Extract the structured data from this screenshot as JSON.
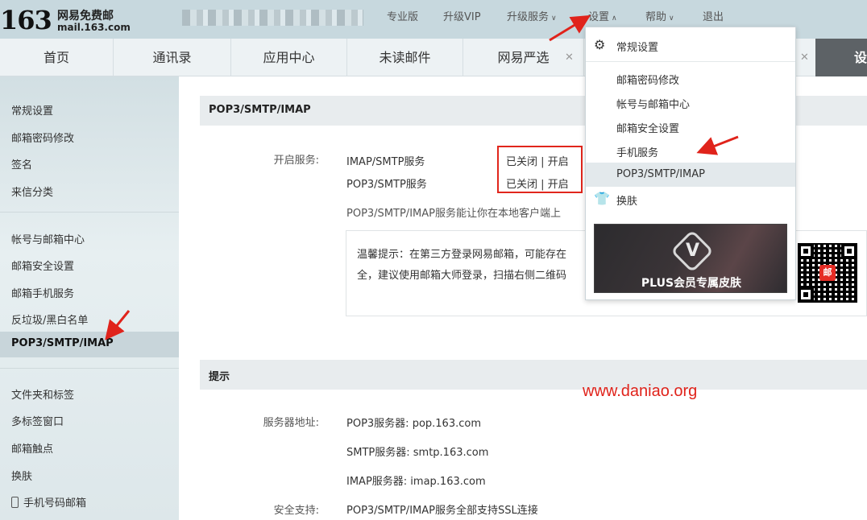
{
  "header": {
    "logo_number": "163",
    "logo_name": "网易免费邮",
    "logo_domain": "mail.163.com",
    "nav": [
      "专业版",
      "升级VIP",
      "升级服务",
      "设置",
      "帮助",
      "退出"
    ]
  },
  "tabs": [
    "首页",
    "通讯录",
    "应用中心",
    "未读邮件",
    "网易严选"
  ],
  "active_tab": "设置",
  "sidebar": {
    "group1": [
      "常规设置",
      "邮箱密码修改",
      "签名",
      "来信分类"
    ],
    "group2": [
      "帐号与邮箱中心",
      "邮箱安全设置",
      "邮箱手机服务",
      "反垃圾/黑白名单"
    ],
    "active": "POP3/SMTP/IMAP",
    "group3": [
      "文件夹和标签",
      "多标签窗口",
      "邮箱触点",
      "换肤",
      "手机号码邮箱"
    ]
  },
  "main": {
    "section1_title": "POP3/SMTP/IMAP",
    "service_label": "开启服务:",
    "services": [
      {
        "name": "IMAP/SMTP服务",
        "status": "已关闭 | 开启"
      },
      {
        "name": "POP3/SMTP服务",
        "status": "已关闭 | 开启"
      }
    ],
    "desc": "POP3/SMTP/IMAP服务能让你在本地客户端上",
    "tip_line1": "温馨提示：在第三方登录网易邮箱，可能存在",
    "tip_line2": "全，建议使用邮箱大师登录，扫描右侧二维码",
    "section2_title": "提示",
    "server_label": "服务器地址:",
    "servers": [
      "POP3服务器: pop.163.com",
      "SMTP服务器: smtp.163.com",
      "IMAP服务器: imap.163.com"
    ],
    "security_label": "安全支持:",
    "security_value": "POP3/SMTP/IMAP服务全部支持SSL连接"
  },
  "dropdown": {
    "general": "常规设置",
    "items": [
      "邮箱密码修改",
      "帐号与邮箱中心",
      "邮箱安全设置",
      "手机服务",
      "POP3/SMTP/IMAP"
    ],
    "skin": "换肤",
    "banner_text": "PLUS会员专属皮肤",
    "banner_letter": "V"
  },
  "qr_badge": "邮",
  "watermark": "www.daniao.org",
  "colors": {
    "accent_red": "#e0231b",
    "header_bg": "#c7d8de",
    "active_tab_bg": "#5d6266"
  }
}
